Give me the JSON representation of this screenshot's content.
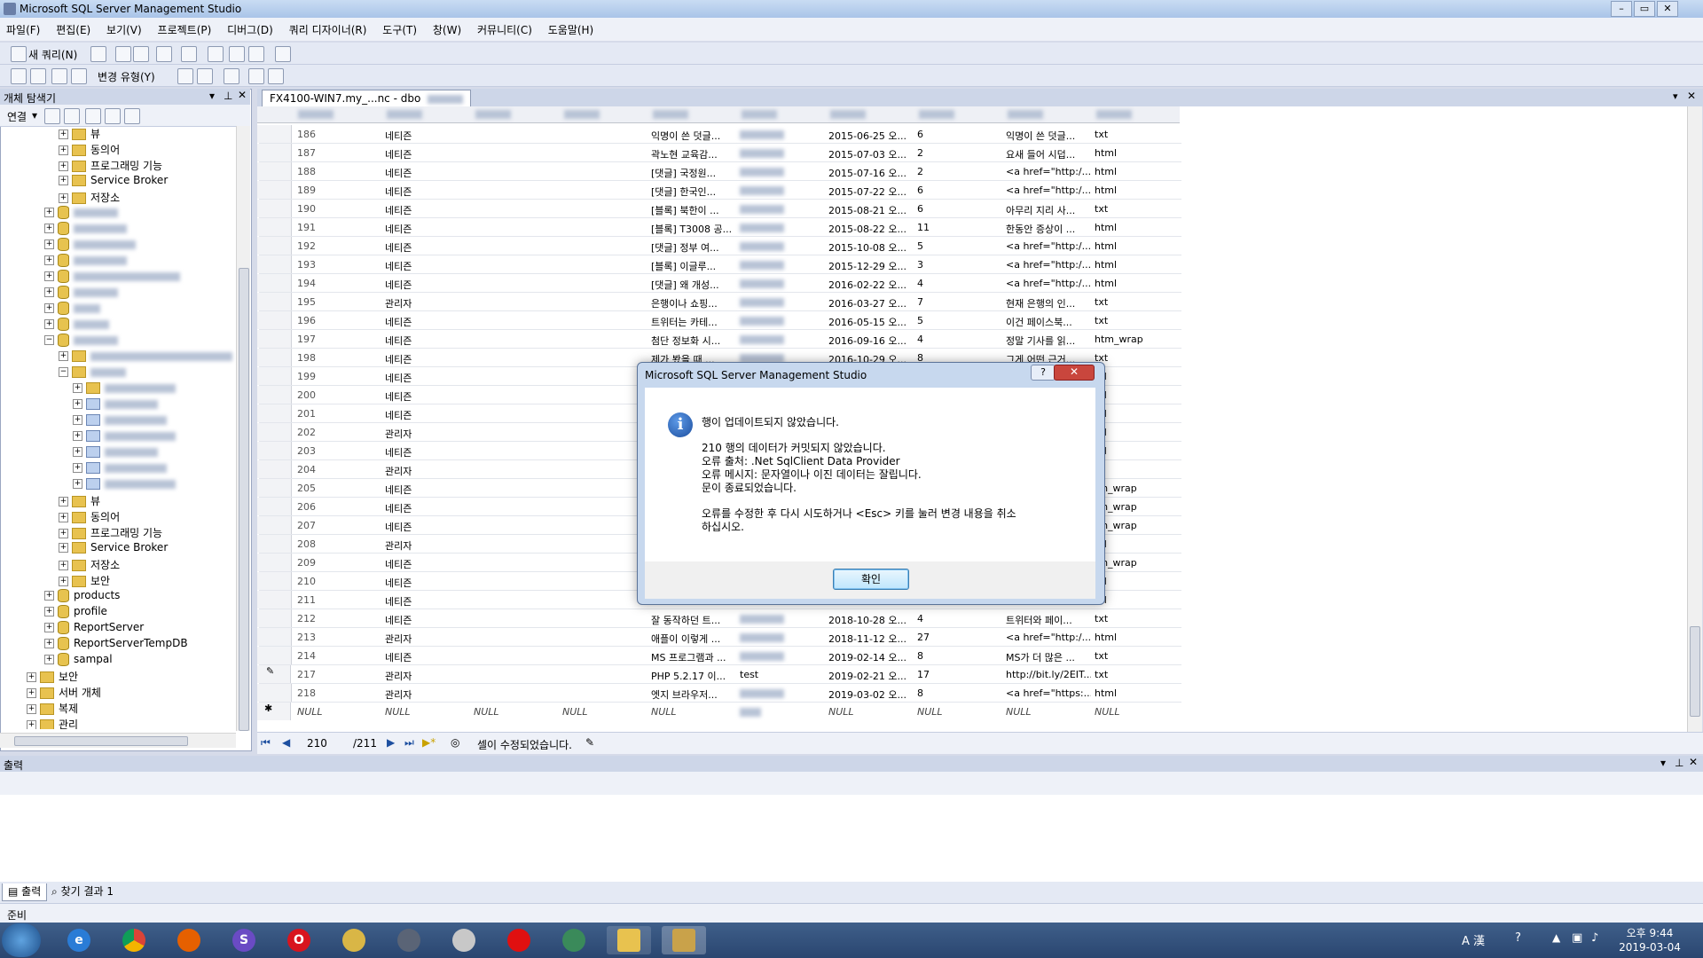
{
  "window": {
    "title": "Microsoft SQL Server Management Studio"
  },
  "menu": [
    "파일(F)",
    "편집(E)",
    "보기(V)",
    "프로젝트(P)",
    "디버그(D)",
    "쿼리 디자이너(R)",
    "도구(T)",
    "창(W)",
    "커뮤니티(C)",
    "도움말(H)"
  ],
  "toolbar": {
    "new_query": "새 쿼리(N)",
    "change_type": "변경 유형(Y)"
  },
  "object_explorer": {
    "title": "개체 탐색기",
    "connect": "연결",
    "upper_items": [
      "뷰",
      "동의어",
      "프로그래밍 기능",
      "Service Broker",
      "저장소"
    ],
    "lower_items": [
      "뷰",
      "동의어",
      "프로그래밍 기능",
      "Service Broker",
      "저장소",
      "보안"
    ],
    "databases": [
      "products",
      "profile",
      "ReportServer",
      "ReportServerTempDB",
      "sampal"
    ],
    "root_items": [
      "보안",
      "서버 개체",
      "복제",
      "관리"
    ]
  },
  "document": {
    "tab_title": "FX4100-WIN7.my_...nc - dbo"
  },
  "grid": {
    "rows": [
      {
        "id": "186",
        "a": "네티즌",
        "t": "익명이 쓴 덧글...",
        "d": "2015-06-25 오...",
        "n": "6",
        "c": "익명이 쓴 덧글...",
        "f": "txt"
      },
      {
        "id": "187",
        "a": "네티즌",
        "t": "곽노현 교육감...",
        "d": "2015-07-03 오...",
        "n": "2",
        "c": "요새 들어 시덥...",
        "f": "html"
      },
      {
        "id": "188",
        "a": "네티즌",
        "t": "[댓글] 국정원...",
        "d": "2015-07-16 오...",
        "n": "2",
        "c": "<a href=\"http:/...",
        "f": "html"
      },
      {
        "id": "189",
        "a": "네티즌",
        "t": "[댓글] 한국인...",
        "d": "2015-07-22 오...",
        "n": "6",
        "c": "<a href=\"http:/...",
        "f": "html"
      },
      {
        "id": "190",
        "a": "네티즌",
        "t": "[블록] 북한이 ...",
        "d": "2015-08-21 오...",
        "n": "6",
        "c": "아무리 지리 사...",
        "f": "txt"
      },
      {
        "id": "191",
        "a": "네티즌",
        "t": "[블록] T3008 공...",
        "d": "2015-08-22 오...",
        "n": "11",
        "c": "한동안 증상이 ...",
        "f": "html"
      },
      {
        "id": "192",
        "a": "네티즌",
        "t": "[댓글] 정부 여...",
        "d": "2015-10-08 오...",
        "n": "5",
        "c": "<a href=\"http:/...",
        "f": "html"
      },
      {
        "id": "193",
        "a": "네티즌",
        "t": "[블록] 이글루...",
        "d": "2015-12-29 오...",
        "n": "3",
        "c": "<a href=\"http:/...",
        "f": "html"
      },
      {
        "id": "194",
        "a": "네티즌",
        "t": "[댓글] 왜 개성...",
        "d": "2016-02-22 오...",
        "n": "4",
        "c": "<a href=\"http:/...",
        "f": "html"
      },
      {
        "id": "195",
        "a": "관리자",
        "t": "은행이나 쇼핑...",
        "d": "2016-03-27 오...",
        "n": "7",
        "c": "현재 은행의 인...",
        "f": "txt"
      },
      {
        "id": "196",
        "a": "네티즌",
        "t": "트위터는 카테...",
        "d": "2016-05-15 오...",
        "n": "5",
        "c": "이건 페이스북...",
        "f": "txt"
      },
      {
        "id": "197",
        "a": "네티즌",
        "t": "첨단 정보화 시...",
        "d": "2016-09-16 오...",
        "n": "4",
        "c": "정말 기사를 읽...",
        "f": "htm_wrap"
      },
      {
        "id": "198",
        "a": "네티즌",
        "t": "제가 봤을 때 ...",
        "d": "2016-10-29 오...",
        "n": "8",
        "c": "그게 어떤 근거...",
        "f": "txt"
      },
      {
        "id": "199",
        "a": "네티즌",
        "t": "",
        "d": "",
        "n": "",
        "c": "",
        "f": "ml"
      },
      {
        "id": "200",
        "a": "네티즌",
        "t": "",
        "d": "",
        "n": "",
        "c": "",
        "f": "ml"
      },
      {
        "id": "201",
        "a": "네티즌",
        "t": "",
        "d": "",
        "n": "",
        "c": "",
        "f": "ml"
      },
      {
        "id": "202",
        "a": "관리자",
        "t": "",
        "d": "",
        "n": "",
        "c": "",
        "f": "ml"
      },
      {
        "id": "203",
        "a": "네티즌",
        "t": "",
        "d": "",
        "n": "",
        "c": "",
        "f": "ml"
      },
      {
        "id": "204",
        "a": "관리자",
        "t": "",
        "d": "",
        "n": "",
        "c": "",
        "f": "t"
      },
      {
        "id": "205",
        "a": "네티즌",
        "t": "",
        "d": "",
        "n": "",
        "c": "",
        "f": "tm_wrap"
      },
      {
        "id": "206",
        "a": "네티즌",
        "t": "",
        "d": "",
        "n": "",
        "c": "",
        "f": "tm_wrap"
      },
      {
        "id": "207",
        "a": "네티즌",
        "t": "",
        "d": "",
        "n": "",
        "c": "",
        "f": "tm_wrap"
      },
      {
        "id": "208",
        "a": "관리자",
        "t": "",
        "d": "",
        "n": "",
        "c": "",
        "f": "ml"
      },
      {
        "id": "209",
        "a": "네티즌",
        "t": "",
        "d": "",
        "n": "",
        "c": "",
        "f": "tm_wrap"
      },
      {
        "id": "210",
        "a": "네티즌",
        "t": "",
        "d": "",
        "n": "",
        "c": "",
        "f": "ml"
      },
      {
        "id": "211",
        "a": "네티즌",
        "t": "",
        "d": "",
        "n": "",
        "c": "",
        "f": "ml"
      },
      {
        "id": "212",
        "a": "네티즌",
        "t": "잘 동작하던 트...",
        "d": "2018-10-28 오...",
        "n": "4",
        "c": "트위터와 페이...",
        "f": "txt"
      },
      {
        "id": "213",
        "a": "관리자",
        "t": "애플이 이렇게 ...",
        "d": "2018-11-12 오...",
        "n": "27",
        "c": "<a href=\"http:/...",
        "f": "html"
      },
      {
        "id": "214",
        "a": "네티즌",
        "t": "MS 프로그램과 ...",
        "d": "2019-02-14 오...",
        "n": "8",
        "c": "MS가 더 많은 ...",
        "f": "txt"
      },
      {
        "id": "217",
        "a": "관리자",
        "t": "PHP 5.2.17 이...",
        "u": "test",
        "d": "2019-02-21 오...",
        "n": "17",
        "c": "http://bit.ly/2EIT...",
        "f": "txt"
      },
      {
        "id": "218",
        "a": "관리자",
        "t": "엣지 브라우저...",
        "d": "2019-03-02 오...",
        "n": "8",
        "c": "<a href=\"https:...",
        "f": "html"
      }
    ],
    "null_label": "NULL"
  },
  "navigation": {
    "current": "210",
    "total": "/211",
    "status": "셀이 수정되었습니다."
  },
  "dialog": {
    "title": "Microsoft SQL Server Management Studio",
    "help": "?",
    "heading": "행이 업데이트되지 않았습니다.",
    "line1": "210 행의 데이터가 커밋되지 않았습니다.",
    "line2": "오류 출처: .Net SqlClient Data Provider",
    "line3": "오류 메시지: 문자열이나 이진 데이터는 잘립니다.",
    "line4": "문이 종료되었습니다.",
    "line5": "오류를 수정한 후 다시 시도하거나 <Esc> 키를 눌러 변경 내용을 취소",
    "line6": "하십시오.",
    "ok": "확인"
  },
  "output": {
    "title": "출력",
    "tab1": "출력",
    "tab2": "찾기 결과 1"
  },
  "status": {
    "text": "준비"
  },
  "taskbar": {
    "time": "오후 9:44",
    "date": "2019-03-04"
  }
}
